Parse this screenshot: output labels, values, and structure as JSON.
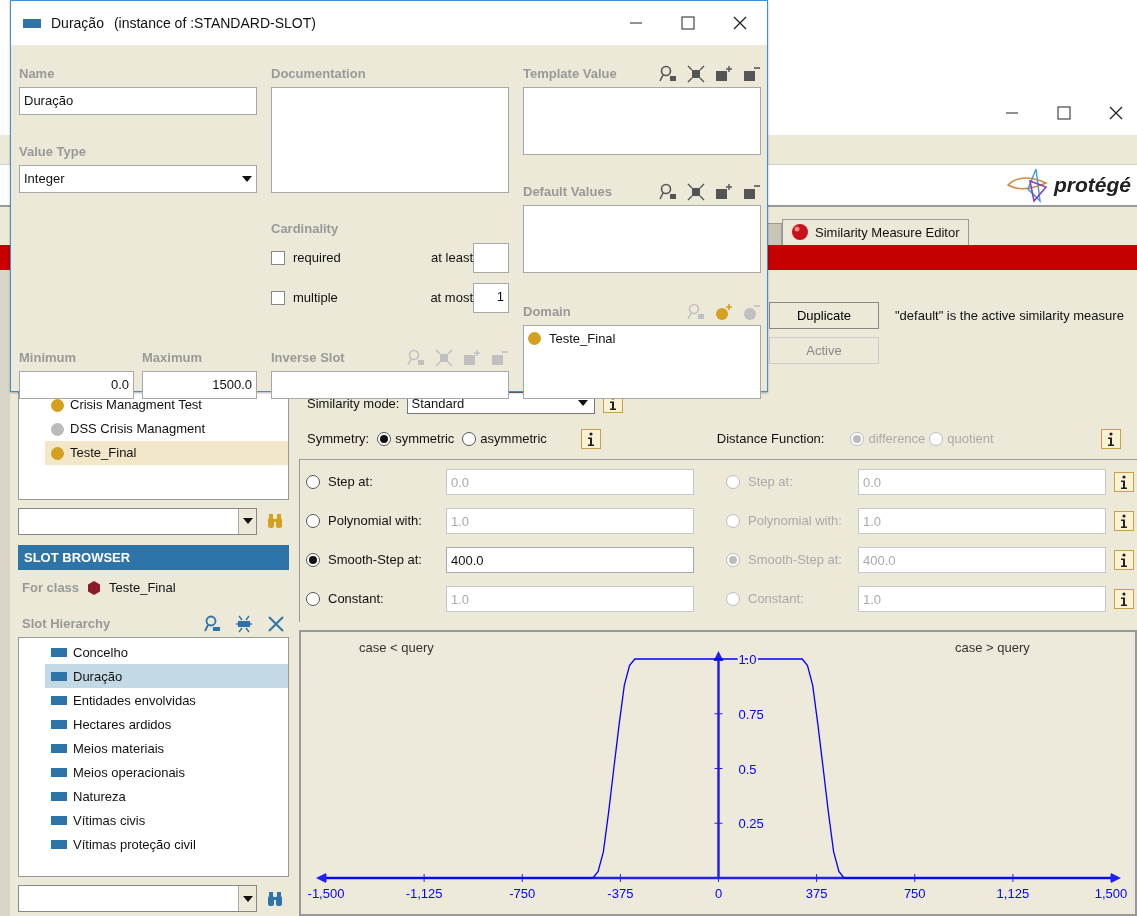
{
  "dialog": {
    "title": "Duração",
    "subtitle": "(instance of :STANDARD-SLOT)",
    "name": {
      "label": "Name",
      "value": "Duração"
    },
    "value_type": {
      "label": "Value Type",
      "value": "Integer"
    },
    "minimum": {
      "label": "Minimum",
      "value": "0.0"
    },
    "maximum": {
      "label": "Maximum",
      "value": "1500.0"
    },
    "documentation": {
      "label": "Documentation"
    },
    "cardinality": {
      "label": "Cardinality",
      "required": {
        "label": "required",
        "checked": false
      },
      "multiple": {
        "label": "multiple",
        "checked": false
      },
      "at_least": {
        "label": "at least"
      },
      "at_most": {
        "label": "at most",
        "value": "1"
      }
    },
    "inverse_slot": {
      "label": "Inverse Slot",
      "tools": [
        {
          "kind": "find",
          "disabled": true
        },
        {
          "kind": "select",
          "disabled": true
        },
        {
          "kind": "add",
          "disabled": true
        },
        {
          "kind": "remove",
          "disabled": true
        }
      ]
    },
    "template_value": {
      "label": "Template Value",
      "tools": [
        {
          "kind": "find",
          "disabled": false
        },
        {
          "kind": "select",
          "disabled": false
        },
        {
          "kind": "add",
          "disabled": false
        },
        {
          "kind": "remove",
          "disabled": false
        }
      ]
    },
    "default_values": {
      "label": "Default Values",
      "tools": [
        {
          "kind": "find",
          "disabled": false
        },
        {
          "kind": "select",
          "disabled": false
        },
        {
          "kind": "add",
          "disabled": false
        },
        {
          "kind": "remove",
          "disabled": false
        }
      ]
    },
    "domain": {
      "label": "Domain",
      "tools": [
        {
          "kind": "find",
          "disabled": true
        },
        {
          "kind": "add_circle",
          "disabled": false
        },
        {
          "kind": "remove_circle",
          "disabled": true
        }
      ],
      "items": [
        {
          "label": "Teste_Final",
          "color": "#d4a020"
        }
      ]
    }
  },
  "main": {
    "logo": "protégé",
    "tabs": [
      {
        "label": "Similarity Measure Editor",
        "selected": true
      }
    ],
    "buttons": [
      {
        "label": "Duplicate",
        "disabled": false
      },
      {
        "label": "Active",
        "disabled": true
      }
    ],
    "active_note": "\"default\" is the active similarity measure",
    "similarity_mode": {
      "label": "Similarity mode:",
      "value": "Standard"
    },
    "symmetry": {
      "label": "Symmetry:",
      "options": [
        {
          "label": "symmetric",
          "selected": true
        },
        {
          "label": "asymmetric",
          "selected": false
        }
      ]
    },
    "distance_function": {
      "label": "Distance Function:",
      "disabled": true,
      "options": [
        {
          "label": "difference",
          "selected": true
        },
        {
          "label": "quotient",
          "selected": false
        }
      ]
    },
    "functions": [
      {
        "label": "Step at:",
        "value": "0.0",
        "selected": false
      },
      {
        "label": "Polynomial with:",
        "value": "1.0",
        "selected": false
      },
      {
        "label": "Smooth-Step at:",
        "value": "400.0",
        "selected": true
      },
      {
        "label": "Constant:",
        "value": "1.0",
        "selected": false
      }
    ],
    "functions_right": {
      "disabled": true,
      "rows": [
        {
          "label": "Step at:",
          "value": "0.0",
          "selected": false
        },
        {
          "label": "Polynomial with:",
          "value": "1.0",
          "selected": false
        },
        {
          "label": "Smooth-Step at:",
          "value": "400.0",
          "selected": true
        },
        {
          "label": "Constant:",
          "value": "1.0",
          "selected": false
        }
      ]
    },
    "chart_data": {
      "type": "line",
      "x": [
        -1500,
        -480,
        -460,
        -440,
        -420,
        -400,
        -380,
        -360,
        -340,
        -320,
        320,
        340,
        360,
        380,
        400,
        420,
        440,
        460,
        480,
        1500
      ],
      "series": [
        {
          "color": "#0000ff",
          "values": [
            0,
            0,
            0.03,
            0.12,
            0.3,
            0.5,
            0.7,
            0.88,
            0.97,
            1,
            1,
            0.97,
            0.88,
            0.7,
            0.5,
            0.3,
            0.12,
            0.03,
            0,
            0
          ]
        }
      ],
      "xlim": [
        -1500,
        1500
      ],
      "ylim": [
        0,
        1
      ],
      "xticks": [
        {
          "value": -1500,
          "label": "-1,500"
        },
        {
          "value": -1125,
          "label": "-1,125"
        },
        {
          "value": -750,
          "label": "-750"
        },
        {
          "value": -375,
          "label": "-375"
        },
        {
          "value": 0,
          "label": "0"
        },
        {
          "value": 375,
          "label": "375"
        },
        {
          "value": 750,
          "label": "750"
        },
        {
          "value": 1125,
          "label": "1,125"
        },
        {
          "value": 1500,
          "label": "1,500"
        }
      ],
      "yticks": [
        0.25,
        0.5,
        0.75,
        {
          "value": 1,
          "label": "1.0"
        }
      ],
      "annotations": [
        "case < query",
        "case > query"
      ]
    }
  },
  "classes": {
    "items": [
      {
        "label": "Crisis Managment Test",
        "color": "#d4a020",
        "selected": false
      },
      {
        "label": "DSS Crisis Managment",
        "color": "#bbbbbb",
        "selected": false
      },
      {
        "label": "Teste_Final",
        "color": "#d4a020",
        "selected": true
      }
    ]
  },
  "slot_browser": {
    "title": "SLOT BROWSER",
    "for_class_label": "For class",
    "for_class": "Teste_Final",
    "hierarchy_label": "Slot Hierarchy",
    "slots": [
      {
        "label": "Concelho",
        "selected": false
      },
      {
        "label": "Duração",
        "selected": true
      },
      {
        "label": "Entidades envolvidas",
        "selected": false
      },
      {
        "label": "Hectares ardidos",
        "selected": false
      },
      {
        "label": "Meios materiais",
        "selected": false
      },
      {
        "label": "Meios operacionais",
        "selected": false
      },
      {
        "label": "Natureza",
        "selected": false
      },
      {
        "label": "Vítimas civis",
        "selected": false
      },
      {
        "label": "Vítimas proteção civil",
        "selected": false
      }
    ]
  }
}
